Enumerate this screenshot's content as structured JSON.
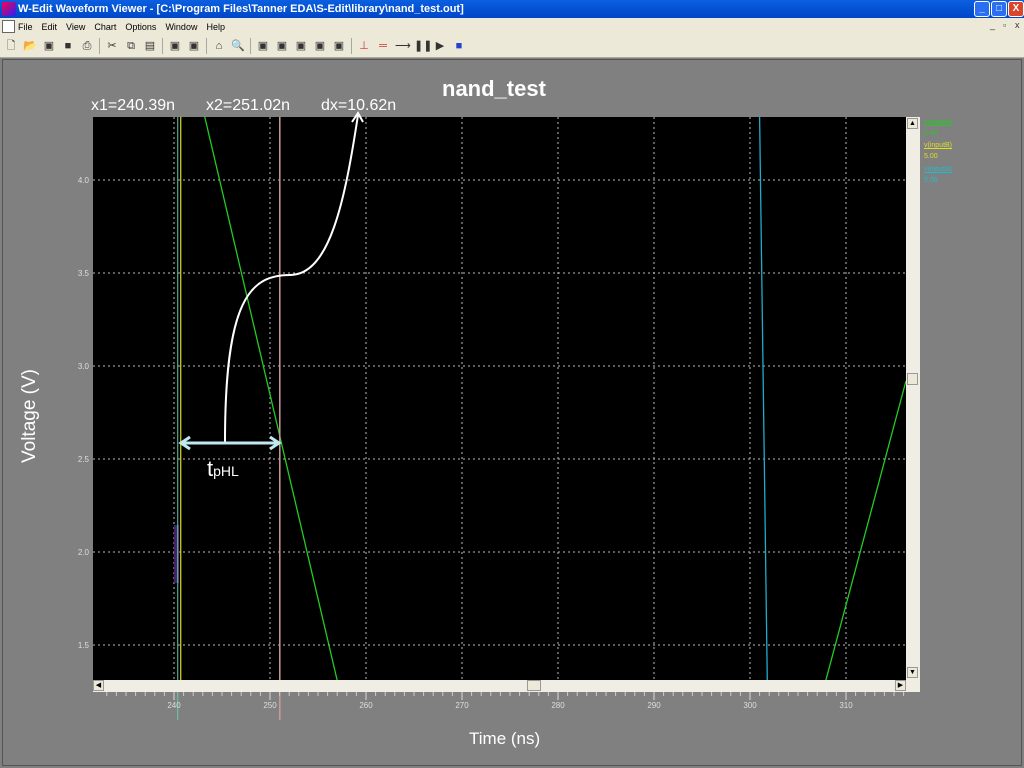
{
  "window": {
    "title": "W-Edit Waveform Viewer - [C:\\Program Files\\Tanner EDA\\S-Edit\\library\\nand_test.out]",
    "min": "_",
    "max": "□",
    "close": "X"
  },
  "menu": [
    "File",
    "Edit",
    "View",
    "Chart",
    "Options",
    "Window",
    "Help"
  ],
  "toolbar_icons": [
    "new-icon",
    "open-icon",
    "open-multi-icon",
    "save-icon",
    "print-icon",
    "cut-icon",
    "copy-icon",
    "paste-icon",
    "list-icon",
    "grid-icon",
    "home-icon",
    "zoom-icon",
    "folder-icon",
    "chart1-icon",
    "chart2-icon",
    "chart3-icon",
    "chart4-icon",
    "cursor-icon",
    "measure-icon",
    "marker-icon",
    "pause-icon",
    "play-icon",
    "book-icon"
  ],
  "chart_data": {
    "type": "line",
    "title": "nand_test",
    "xlabel": "Time (ns)",
    "ylabel": "Voltage (V)",
    "xlim": [
      231.9,
      316.6
    ],
    "ylim": [
      1.31,
      4.34
    ],
    "xticks": [
      240,
      250,
      260,
      270,
      280,
      290,
      300,
      310
    ],
    "yticks": [
      "4.0",
      "3.5",
      "3.0",
      "2.5",
      "2.0",
      "1.5"
    ],
    "cursors": {
      "x1": "x1=240.39n",
      "x2": "x2=251.02n",
      "dx": "dx=10.62n",
      "x1_value": 240.39,
      "x2_value": 251.02
    },
    "annotation": {
      "label": "t",
      "sub": "pHL"
    },
    "series": [
      {
        "name": "v(output)",
        "value": "2.44",
        "color": "#22cc22",
        "x": [
          243.2,
          257.0,
          null,
          307.9,
          316.25
        ],
        "y": [
          4.34,
          1.31,
          null,
          1.31,
          2.92
        ]
      },
      {
        "name": "v(inputB)",
        "value": "5.00",
        "color": "#cccc22",
        "x": [
          240.7,
          240.7
        ],
        "y": [
          4.34,
          1.31
        ]
      },
      {
        "name": "v(inputA)",
        "value": "5.00",
        "color": "#22aacc",
        "x": [
          301.0,
          301.8
        ],
        "y": [
          4.34,
          1.31
        ]
      }
    ]
  }
}
